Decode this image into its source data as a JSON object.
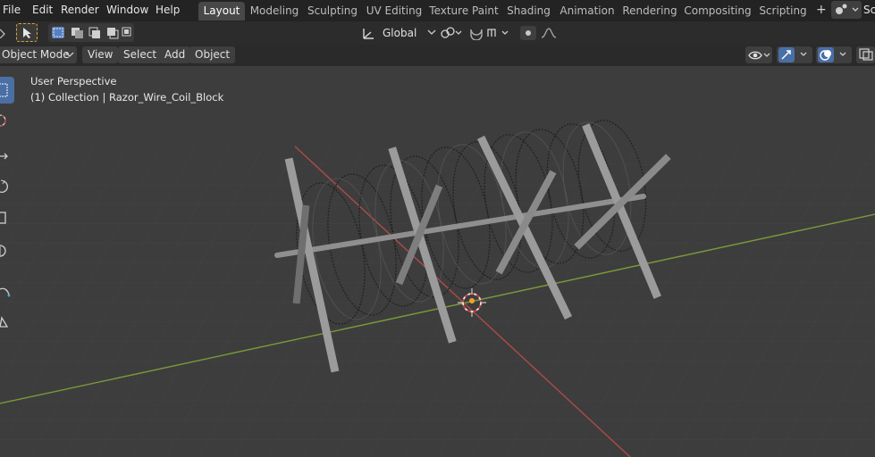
{
  "menu": {
    "file": "File",
    "edit": "Edit",
    "render": "Render",
    "window": "Window",
    "help": "Help"
  },
  "workspaces": [
    {
      "label": "Layout"
    },
    {
      "label": "Modeling"
    },
    {
      "label": "Sculpting"
    },
    {
      "label": "UV Editing"
    },
    {
      "label": "Texture Paint"
    },
    {
      "label": "Shading"
    },
    {
      "label": "Animation"
    },
    {
      "label": "Rendering"
    },
    {
      "label": "Compositing"
    },
    {
      "label": "Scripting"
    }
  ],
  "add_workspace": "+",
  "scene_label": "Sc",
  "header": {
    "orientation": "Global"
  },
  "viewport_header": {
    "mode": "Object Mode",
    "view": "View",
    "select": "Select",
    "add": "Add",
    "object": "Object"
  },
  "viewport": {
    "perspective": "User Perspective",
    "collection": "(1) Collection | Razor_Wire_Coil_Block"
  },
  "colors": {
    "accent": "#4a6fa5",
    "x_axis": "#b04a4a",
    "y_axis": "#7a9a3a",
    "background": "#3d3d3d"
  }
}
